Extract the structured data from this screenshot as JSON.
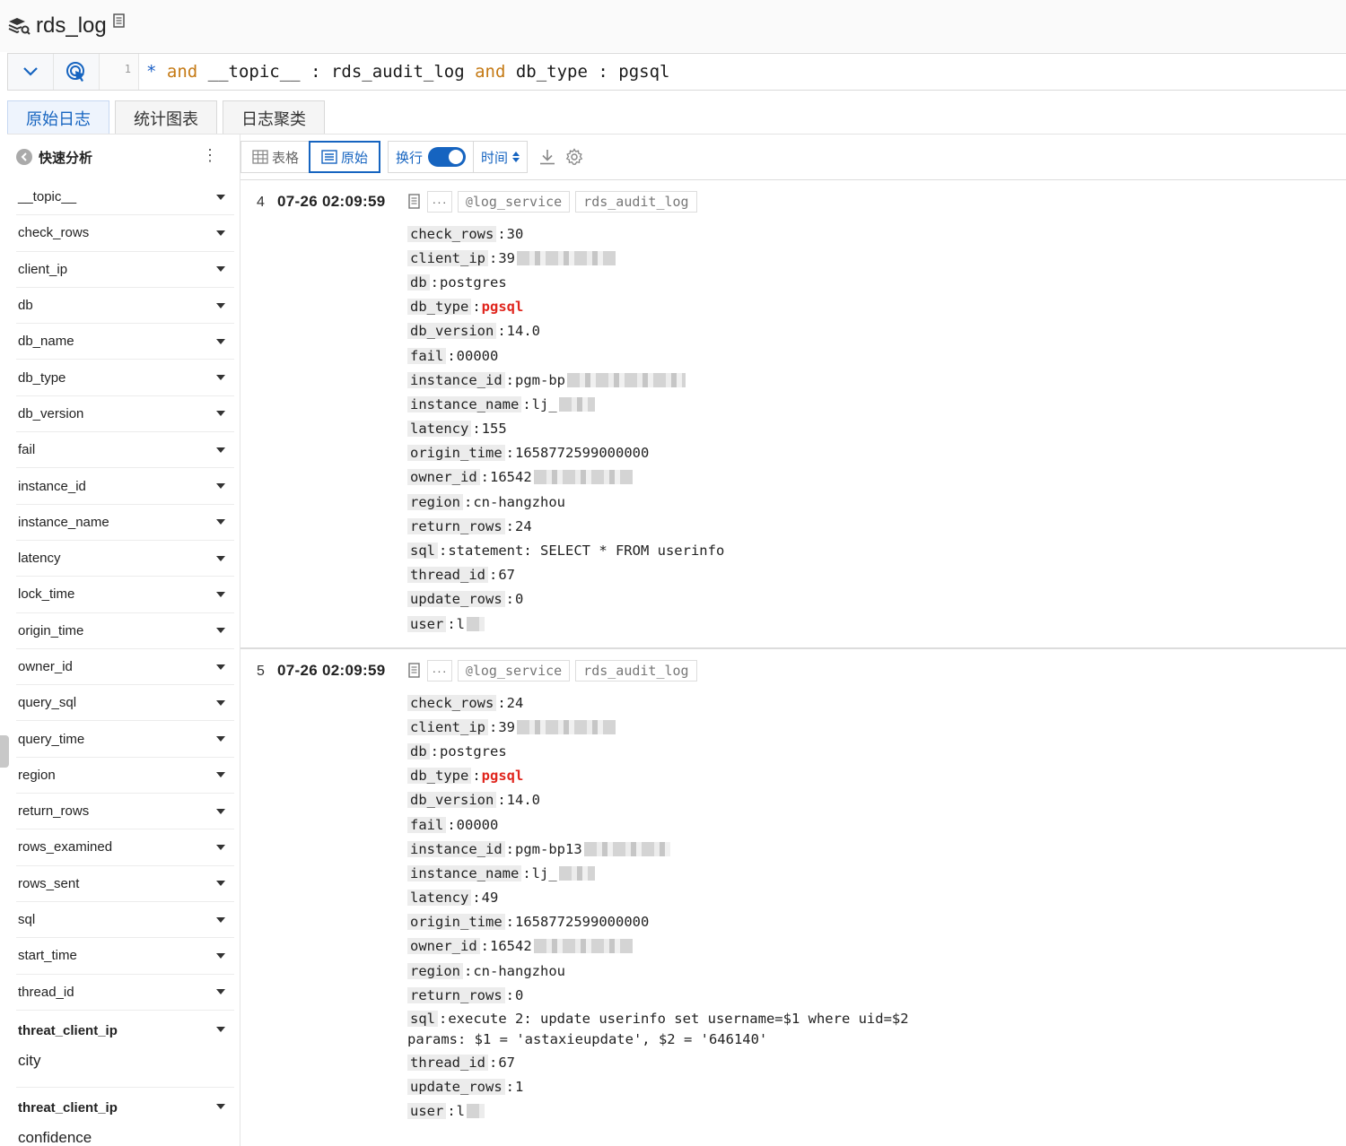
{
  "title": "rds_log",
  "query": {
    "line_number": "1",
    "tokens": [
      {
        "text": "*",
        "kind": "star"
      },
      {
        "text": " ",
        "kind": "id"
      },
      {
        "text": "and",
        "kind": "kw"
      },
      {
        "text": " __topic__ : rds_audit_log ",
        "kind": "id"
      },
      {
        "text": "and",
        "kind": "kw"
      },
      {
        "text": " db_type : pgsql",
        "kind": "id"
      }
    ]
  },
  "tabs": [
    "原始日志",
    "统计图表",
    "日志聚类"
  ],
  "sidebar": {
    "header": "快速分析",
    "fields": [
      "__topic__",
      "check_rows",
      "client_ip",
      "db",
      "db_name",
      "db_type",
      "db_version",
      "fail",
      "instance_id",
      "instance_name",
      "latency",
      "lock_time",
      "origin_time",
      "owner_id",
      "query_sql",
      "query_time",
      "region",
      "return_rows",
      "rows_examined",
      "rows_sent",
      "sql",
      "start_time",
      "thread_id"
    ],
    "extra": [
      {
        "line1": "threat_client_ip",
        "line2": "city"
      },
      {
        "line1": "threat_client_ip",
        "line2": "confidence"
      }
    ]
  },
  "toolbar": {
    "table_label": "表格",
    "raw_label": "原始",
    "wrap_label": "换行",
    "time_label": "时间"
  },
  "logs": [
    {
      "index": "4",
      "time": "07-26 02:09:59",
      "tags": [
        "log_service",
        "rds_audit_log"
      ],
      "fields": [
        {
          "k": "check_rows",
          "v": "30"
        },
        {
          "k": "client_ip",
          "v": "39",
          "mask": 110
        },
        {
          "k": "db",
          "v": "postgres"
        },
        {
          "k": "db_type",
          "v": "pgsql",
          "red": true
        },
        {
          "k": "db_version",
          "v": "14.0"
        },
        {
          "k": "fail",
          "v": "00000"
        },
        {
          "k": "instance_id",
          "v": "pgm-bp",
          "mask": 132
        },
        {
          "k": "instance_name",
          "v": "lj_",
          "mask": 40
        },
        {
          "k": "latency",
          "v": "155"
        },
        {
          "k": "origin_time",
          "v": "1658772599000000"
        },
        {
          "k": "owner_id",
          "v": "16542",
          "mask": 110
        },
        {
          "k": "region",
          "v": "cn-hangzhou"
        },
        {
          "k": "return_rows",
          "v": "24"
        },
        {
          "k": "sql",
          "v": "statement: SELECT * FROM userinfo"
        },
        {
          "k": "thread_id",
          "v": "67"
        },
        {
          "k": "update_rows",
          "v": "0"
        },
        {
          "k": "user",
          "v": "l",
          "mask": 20
        }
      ]
    },
    {
      "index": "5",
      "time": "07-26 02:09:59",
      "tags": [
        "log_service",
        "rds_audit_log"
      ],
      "fields": [
        {
          "k": "check_rows",
          "v": "24"
        },
        {
          "k": "client_ip",
          "v": "39",
          "mask": 110
        },
        {
          "k": "db",
          "v": "postgres"
        },
        {
          "k": "db_type",
          "v": "pgsql",
          "red": true
        },
        {
          "k": "db_version",
          "v": "14.0"
        },
        {
          "k": "fail",
          "v": "00000"
        },
        {
          "k": "instance_id",
          "v": "pgm-bp13",
          "mask": 96
        },
        {
          "k": "instance_name",
          "v": "lj_",
          "mask": 40
        },
        {
          "k": "latency",
          "v": "49"
        },
        {
          "k": "origin_time",
          "v": "1658772599000000"
        },
        {
          "k": "owner_id",
          "v": "16542",
          "mask": 110
        },
        {
          "k": "region",
          "v": "cn-hangzhou"
        },
        {
          "k": "return_rows",
          "v": "0"
        },
        {
          "k": "sql",
          "v": "execute 2: update userinfo set username=$1 where uid=$2\nparams: $1 = 'astaxieupdate', $2 = '646140'",
          "multi": true
        },
        {
          "k": "thread_id",
          "v": "67"
        },
        {
          "k": "update_rows",
          "v": "1"
        },
        {
          "k": "user",
          "v": "l",
          "mask": 20
        }
      ]
    }
  ]
}
